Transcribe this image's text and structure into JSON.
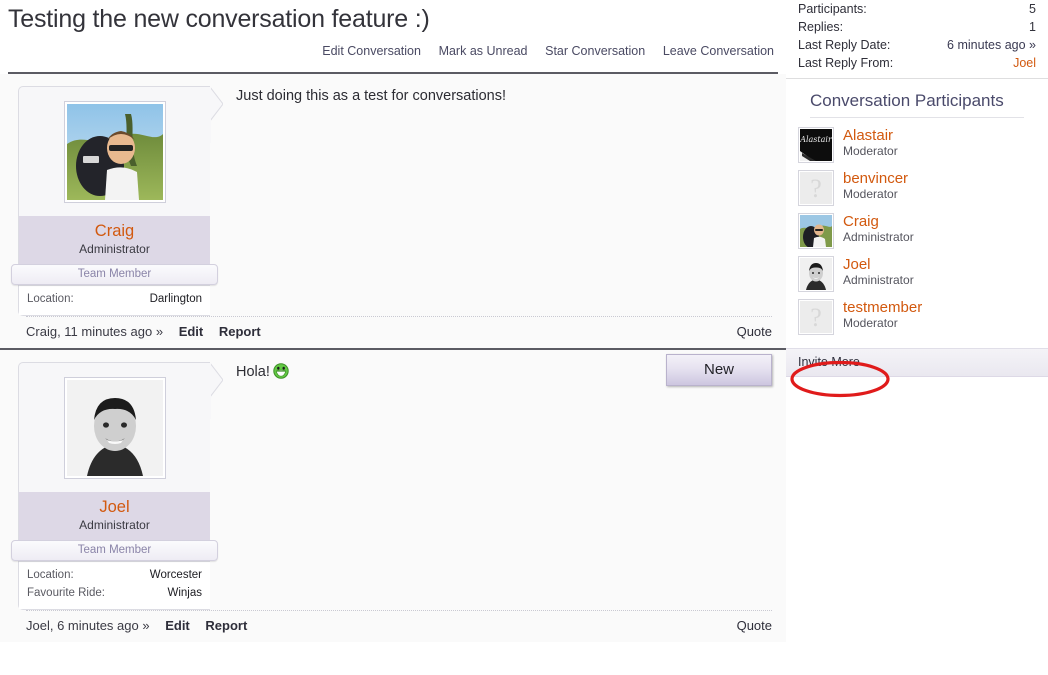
{
  "page": {
    "title": "Testing the new conversation feature :)"
  },
  "conversation_actions": [
    {
      "label": "Edit Conversation",
      "name": "edit-conversation-link"
    },
    {
      "label": "Mark as Unread",
      "name": "mark-as-unread-link"
    },
    {
      "label": "Star Conversation",
      "name": "star-conversation-link"
    },
    {
      "label": "Leave Conversation",
      "name": "leave-conversation-link"
    }
  ],
  "posts": [
    {
      "author": "Craig",
      "author_title": "Administrator",
      "badge": "Team Member",
      "fields": [
        {
          "label": "Location:",
          "value": "Darlington"
        }
      ],
      "message": "Just doing this as a test for conversations!",
      "emoji": "",
      "footer_meta": "Craig, 11 minutes ago »",
      "edit_label": "Edit",
      "report_label": "Report",
      "quote_label": "Quote",
      "new_badge": ""
    },
    {
      "author": "Joel",
      "author_title": "Administrator",
      "badge": "Team Member",
      "fields": [
        {
          "label": "Location:",
          "value": "Worcester"
        },
        {
          "label": "Favourite Ride:",
          "value": "Winjas"
        }
      ],
      "message": "Hola!",
      "emoji": "grinning-face",
      "footer_meta": "Joel, 6 minutes ago »",
      "edit_label": "Edit",
      "report_label": "Report",
      "quote_label": "Quote",
      "new_badge": "New"
    }
  ],
  "sidebar": {
    "info": [
      {
        "label": "Participants:",
        "value": "5",
        "style": "plain"
      },
      {
        "label": "Replies:",
        "value": "1",
        "style": "plain"
      },
      {
        "label": "Last Reply Date:",
        "value": "6 minutes ago »",
        "style": "link"
      },
      {
        "label": "Last Reply From:",
        "value": "Joel",
        "style": "user"
      }
    ],
    "participants_title": "Conversation Participants",
    "participants": [
      {
        "name": "Alastair",
        "role": "Moderator",
        "avatar": "photo-dark"
      },
      {
        "name": "benvincer",
        "role": "Moderator",
        "avatar": "placeholder"
      },
      {
        "name": "Craig",
        "role": "Administrator",
        "avatar": "photo-outdoor"
      },
      {
        "name": "Joel",
        "role": "Administrator",
        "avatar": "photo-portrait"
      },
      {
        "name": "testmember",
        "role": "Moderator",
        "avatar": "placeholder"
      }
    ],
    "invite_label": "Invite More"
  },
  "annotation": {
    "shape": "ellipse",
    "color": "#e01b1b",
    "target": "invite-more-link"
  },
  "colors": {
    "username": "#d2590f",
    "title": "#33333a",
    "panel_heading": "#4a4a6b",
    "name_band": "#ddd8e6",
    "annotation_red": "#e01b1b"
  }
}
